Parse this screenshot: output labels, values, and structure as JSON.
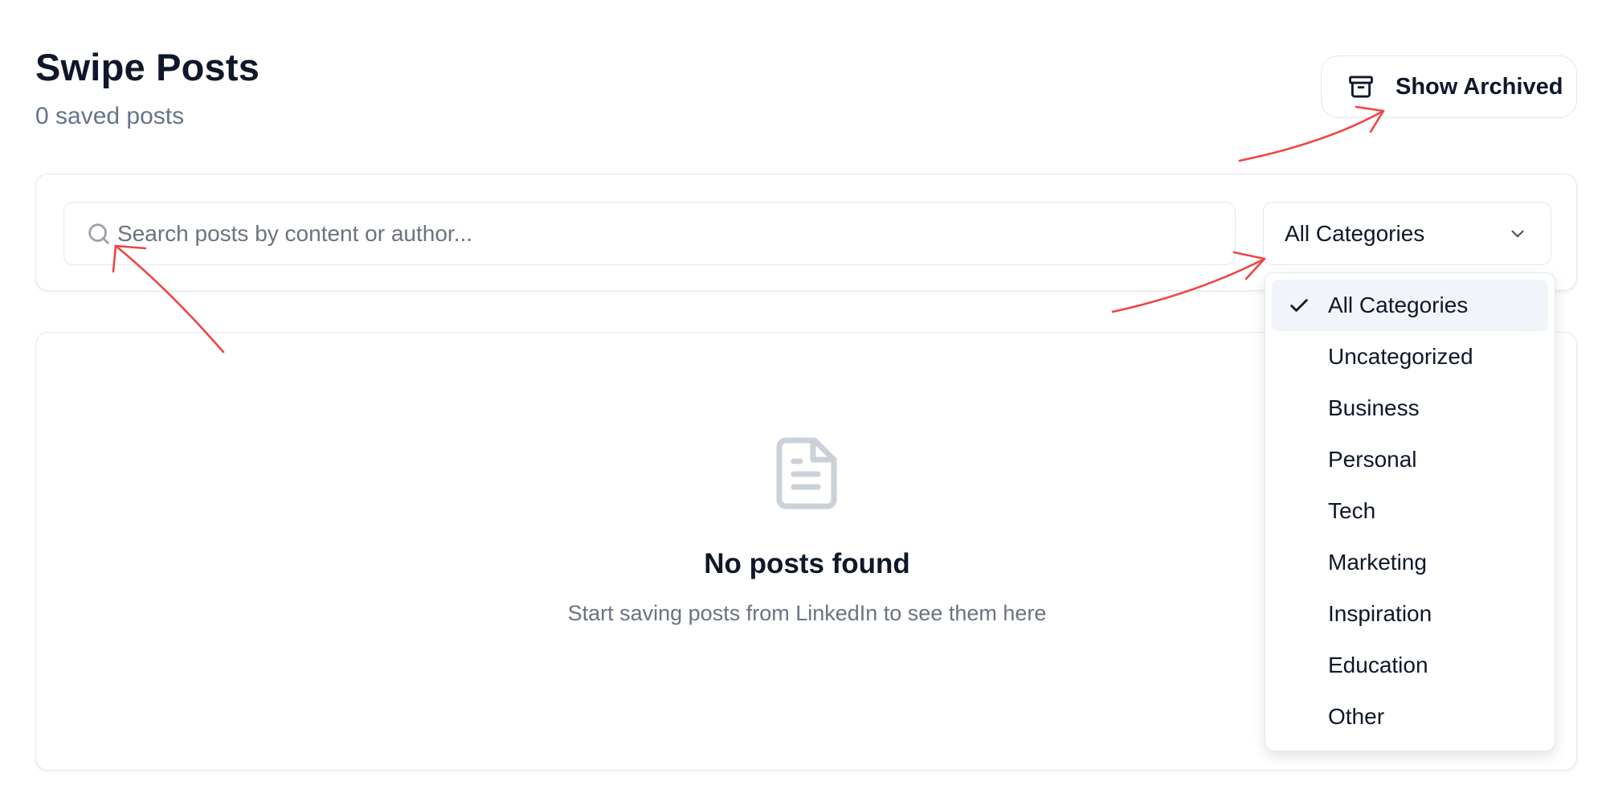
{
  "header": {
    "title": "Swipe Posts",
    "subtitle": "0 saved posts",
    "archived_button_label": "Show Archived"
  },
  "filters": {
    "search_placeholder": "Search posts by content or author...",
    "search_value": "",
    "category_selected": "All Categories",
    "category_options": [
      "All Categories",
      "Uncategorized",
      "Business",
      "Personal",
      "Tech",
      "Marketing",
      "Inspiration",
      "Education",
      "Other"
    ]
  },
  "empty_state": {
    "icon": "file-text-icon",
    "title": "No posts found",
    "message": "Start saving posts from LinkedIn to see them here"
  },
  "icons": {
    "archive": "archive-icon",
    "search": "search-icon",
    "chevron": "chevron-down-icon",
    "check": "check-icon"
  },
  "colors": {
    "text_primary": "#0f172a",
    "text_muted": "#64748b",
    "border": "#e2e8f0",
    "selected_bg": "#f1f5f9",
    "annotation_arrow": "#ef4444"
  }
}
